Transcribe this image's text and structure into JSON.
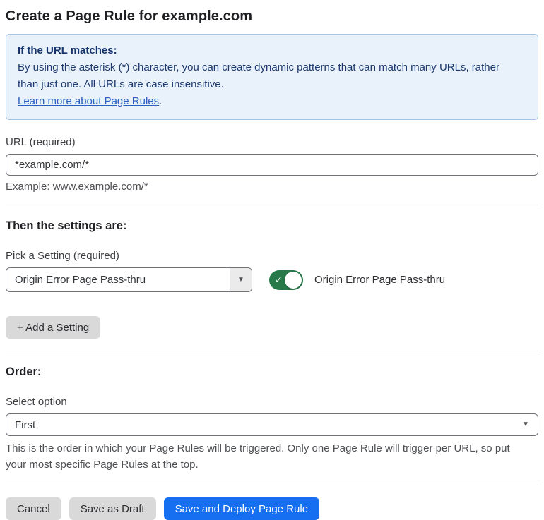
{
  "page": {
    "title": "Create a Page Rule for example.com"
  },
  "info_box": {
    "heading": "If the URL matches:",
    "body": "By using the asterisk (*) character, you can create dynamic patterns that can match many URLs, rather than just one. All URLs are case insensitive.",
    "link_label": "Learn more about Page Rules",
    "link_suffix": "."
  },
  "url_field": {
    "label": "URL (required)",
    "value": "*example.com/*",
    "helper": "Example: www.example.com/*"
  },
  "settings_section": {
    "heading": "Then the settings are:",
    "setting_label": "Pick a Setting (required)",
    "setting_value": "Origin Error Page Pass-thru",
    "toggle_state": "on",
    "toggle_label": "Origin Error Page Pass-thru",
    "add_button_label": "+ Add a Setting"
  },
  "order_section": {
    "heading": "Order:",
    "select_label": "Select option",
    "select_value": "First",
    "helper": "This is the order in which your Page Rules will be triggered. Only one Page Rule will trigger per URL, so put your most specific Page Rules at the top."
  },
  "footer": {
    "cancel_label": "Cancel",
    "save_draft_label": "Save as Draft",
    "save_deploy_label": "Save and Deploy Page Rule"
  },
  "icons": {
    "dropdown_arrow": "▼",
    "check": "✓"
  },
  "colors": {
    "accent_blue": "#156ff0",
    "info_background": "#e9f1fb",
    "info_border": "#a3c4e8",
    "info_text": "#1d3a6e",
    "link_blue": "#2a5fc0",
    "toggle_green": "#27794a",
    "button_gray": "#d9d9d9"
  }
}
